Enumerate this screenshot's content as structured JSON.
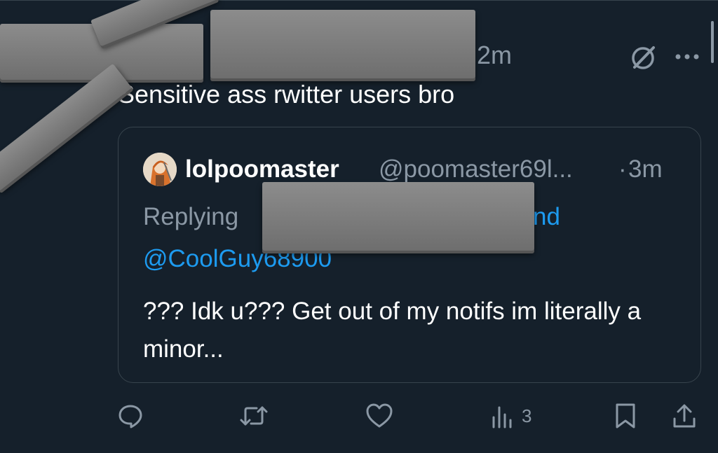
{
  "tweet": {
    "time": "2m",
    "text": "Sensitive ass rwitter users bro"
  },
  "quote": {
    "name": "lolpoomaster",
    "handle": "@poomaster69l...",
    "separator": "·",
    "time": "3m",
    "replying_prefix": "Replying",
    "replying_tail": "nd",
    "replying_mention": "@CoolGuy68900",
    "body": "??? Idk u??? Get out of my notifs im literally a minor..."
  },
  "actions": {
    "views": "3"
  },
  "icons": {
    "header": [
      "grok-icon",
      "more-icon"
    ],
    "action_bar": [
      "reply-icon",
      "retweet-icon",
      "like-icon",
      "views-icon",
      "bookmark-icon",
      "share-icon"
    ]
  },
  "colors": {
    "background": "#15202b",
    "muted": "#8b98a5",
    "link": "#1d9bf0",
    "border": "#38444d"
  }
}
